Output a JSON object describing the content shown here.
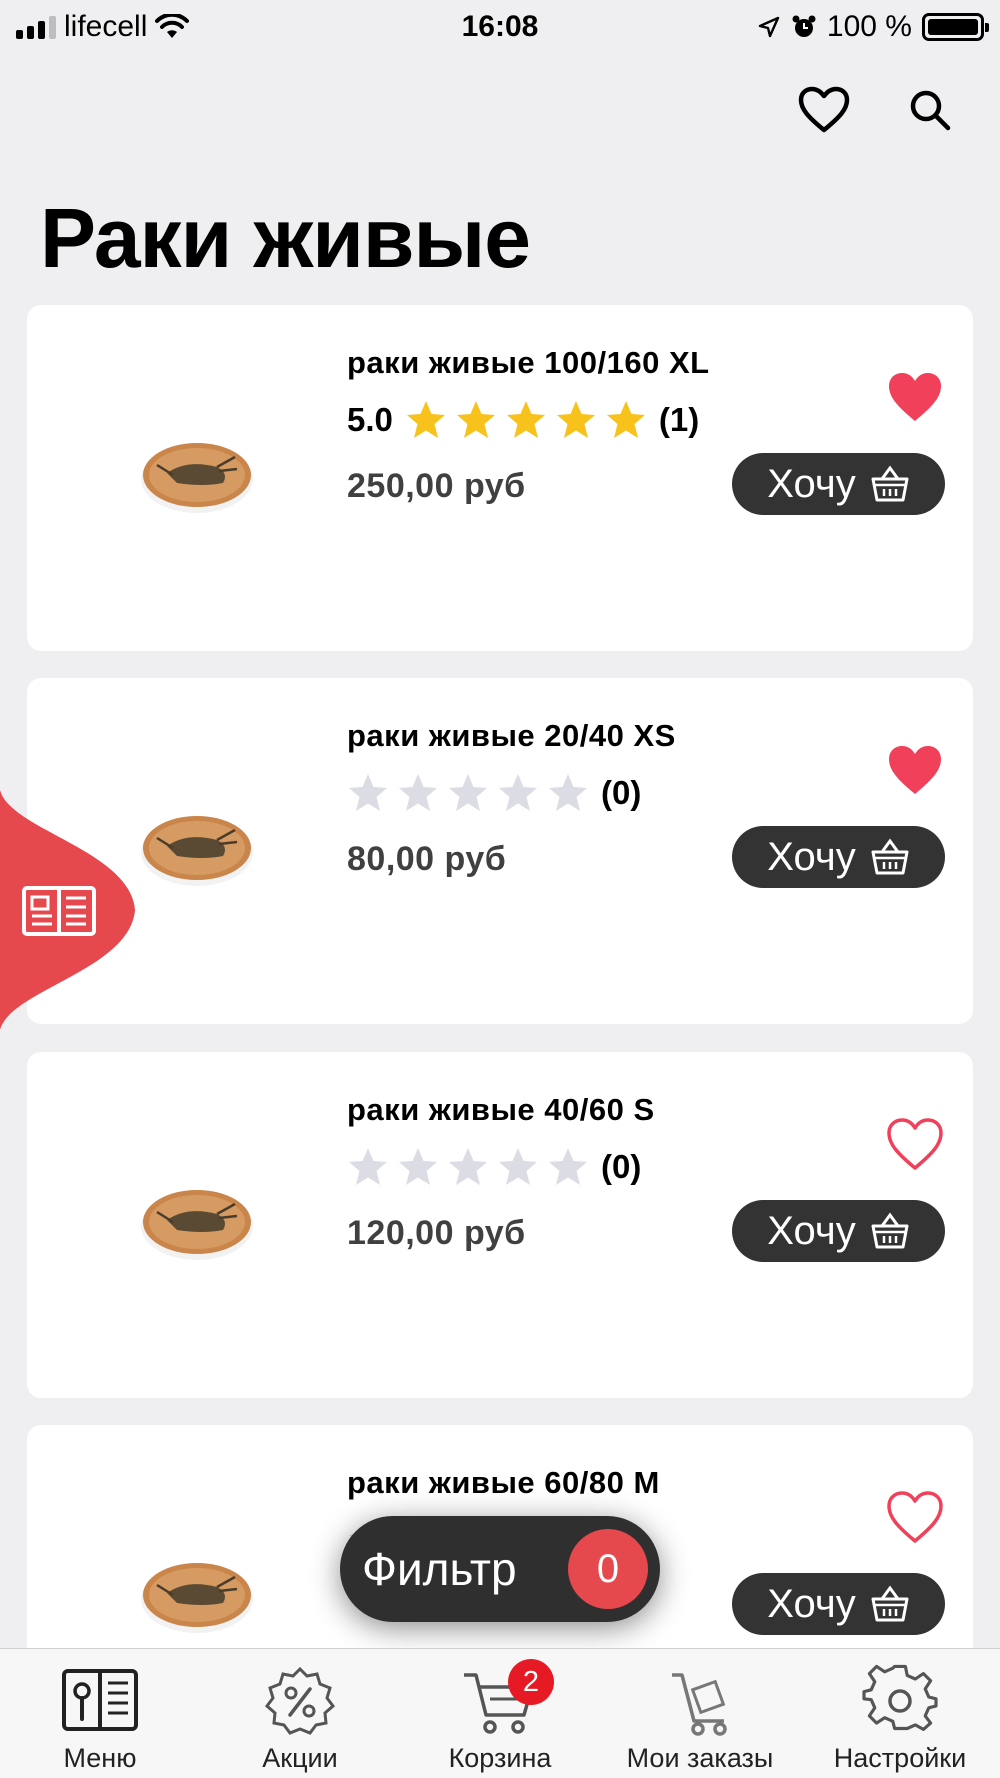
{
  "status_bar": {
    "carrier": "lifecell",
    "time": "16:08",
    "battery": "100 %"
  },
  "page": {
    "title": "Раки живые"
  },
  "products": [
    {
      "name": "раки живые 100/160 XL",
      "rating_value": "5.0",
      "stars": 5,
      "reviews": "(1)",
      "price": "250,00 руб",
      "favorite": true,
      "button": "Хочу"
    },
    {
      "name": "раки живые 20/40 XS",
      "rating_value": "",
      "stars": 0,
      "reviews": "(0)",
      "price": "80,00 руб",
      "favorite": true,
      "button": "Хочу"
    },
    {
      "name": "раки живые 40/60 S",
      "rating_value": "",
      "stars": 0,
      "reviews": "(0)",
      "price": "120,00 руб",
      "favorite": false,
      "button": "Хочу"
    },
    {
      "name": "раки живые 60/80 M",
      "rating_value": "",
      "stars": 0,
      "reviews": "(0)",
      "price": "",
      "favorite": false,
      "button": "Хочу"
    }
  ],
  "filter": {
    "label": "Фильтр",
    "count": "0"
  },
  "tabs": [
    {
      "label": "Меню",
      "icon": "menu-book-icon"
    },
    {
      "label": "Акции",
      "icon": "discount-gear-icon"
    },
    {
      "label": "Корзина",
      "icon": "cart-icon",
      "badge": "2"
    },
    {
      "label": "Мои заказы",
      "icon": "orders-cart-icon"
    },
    {
      "label": "Настройки",
      "icon": "settings-gear-icon"
    }
  ],
  "colors": {
    "accent": "#e5484d",
    "heart": "#f0405a",
    "star_filled": "#f7c21b",
    "star_empty": "#dcdce4",
    "button_dark": "#333333"
  }
}
